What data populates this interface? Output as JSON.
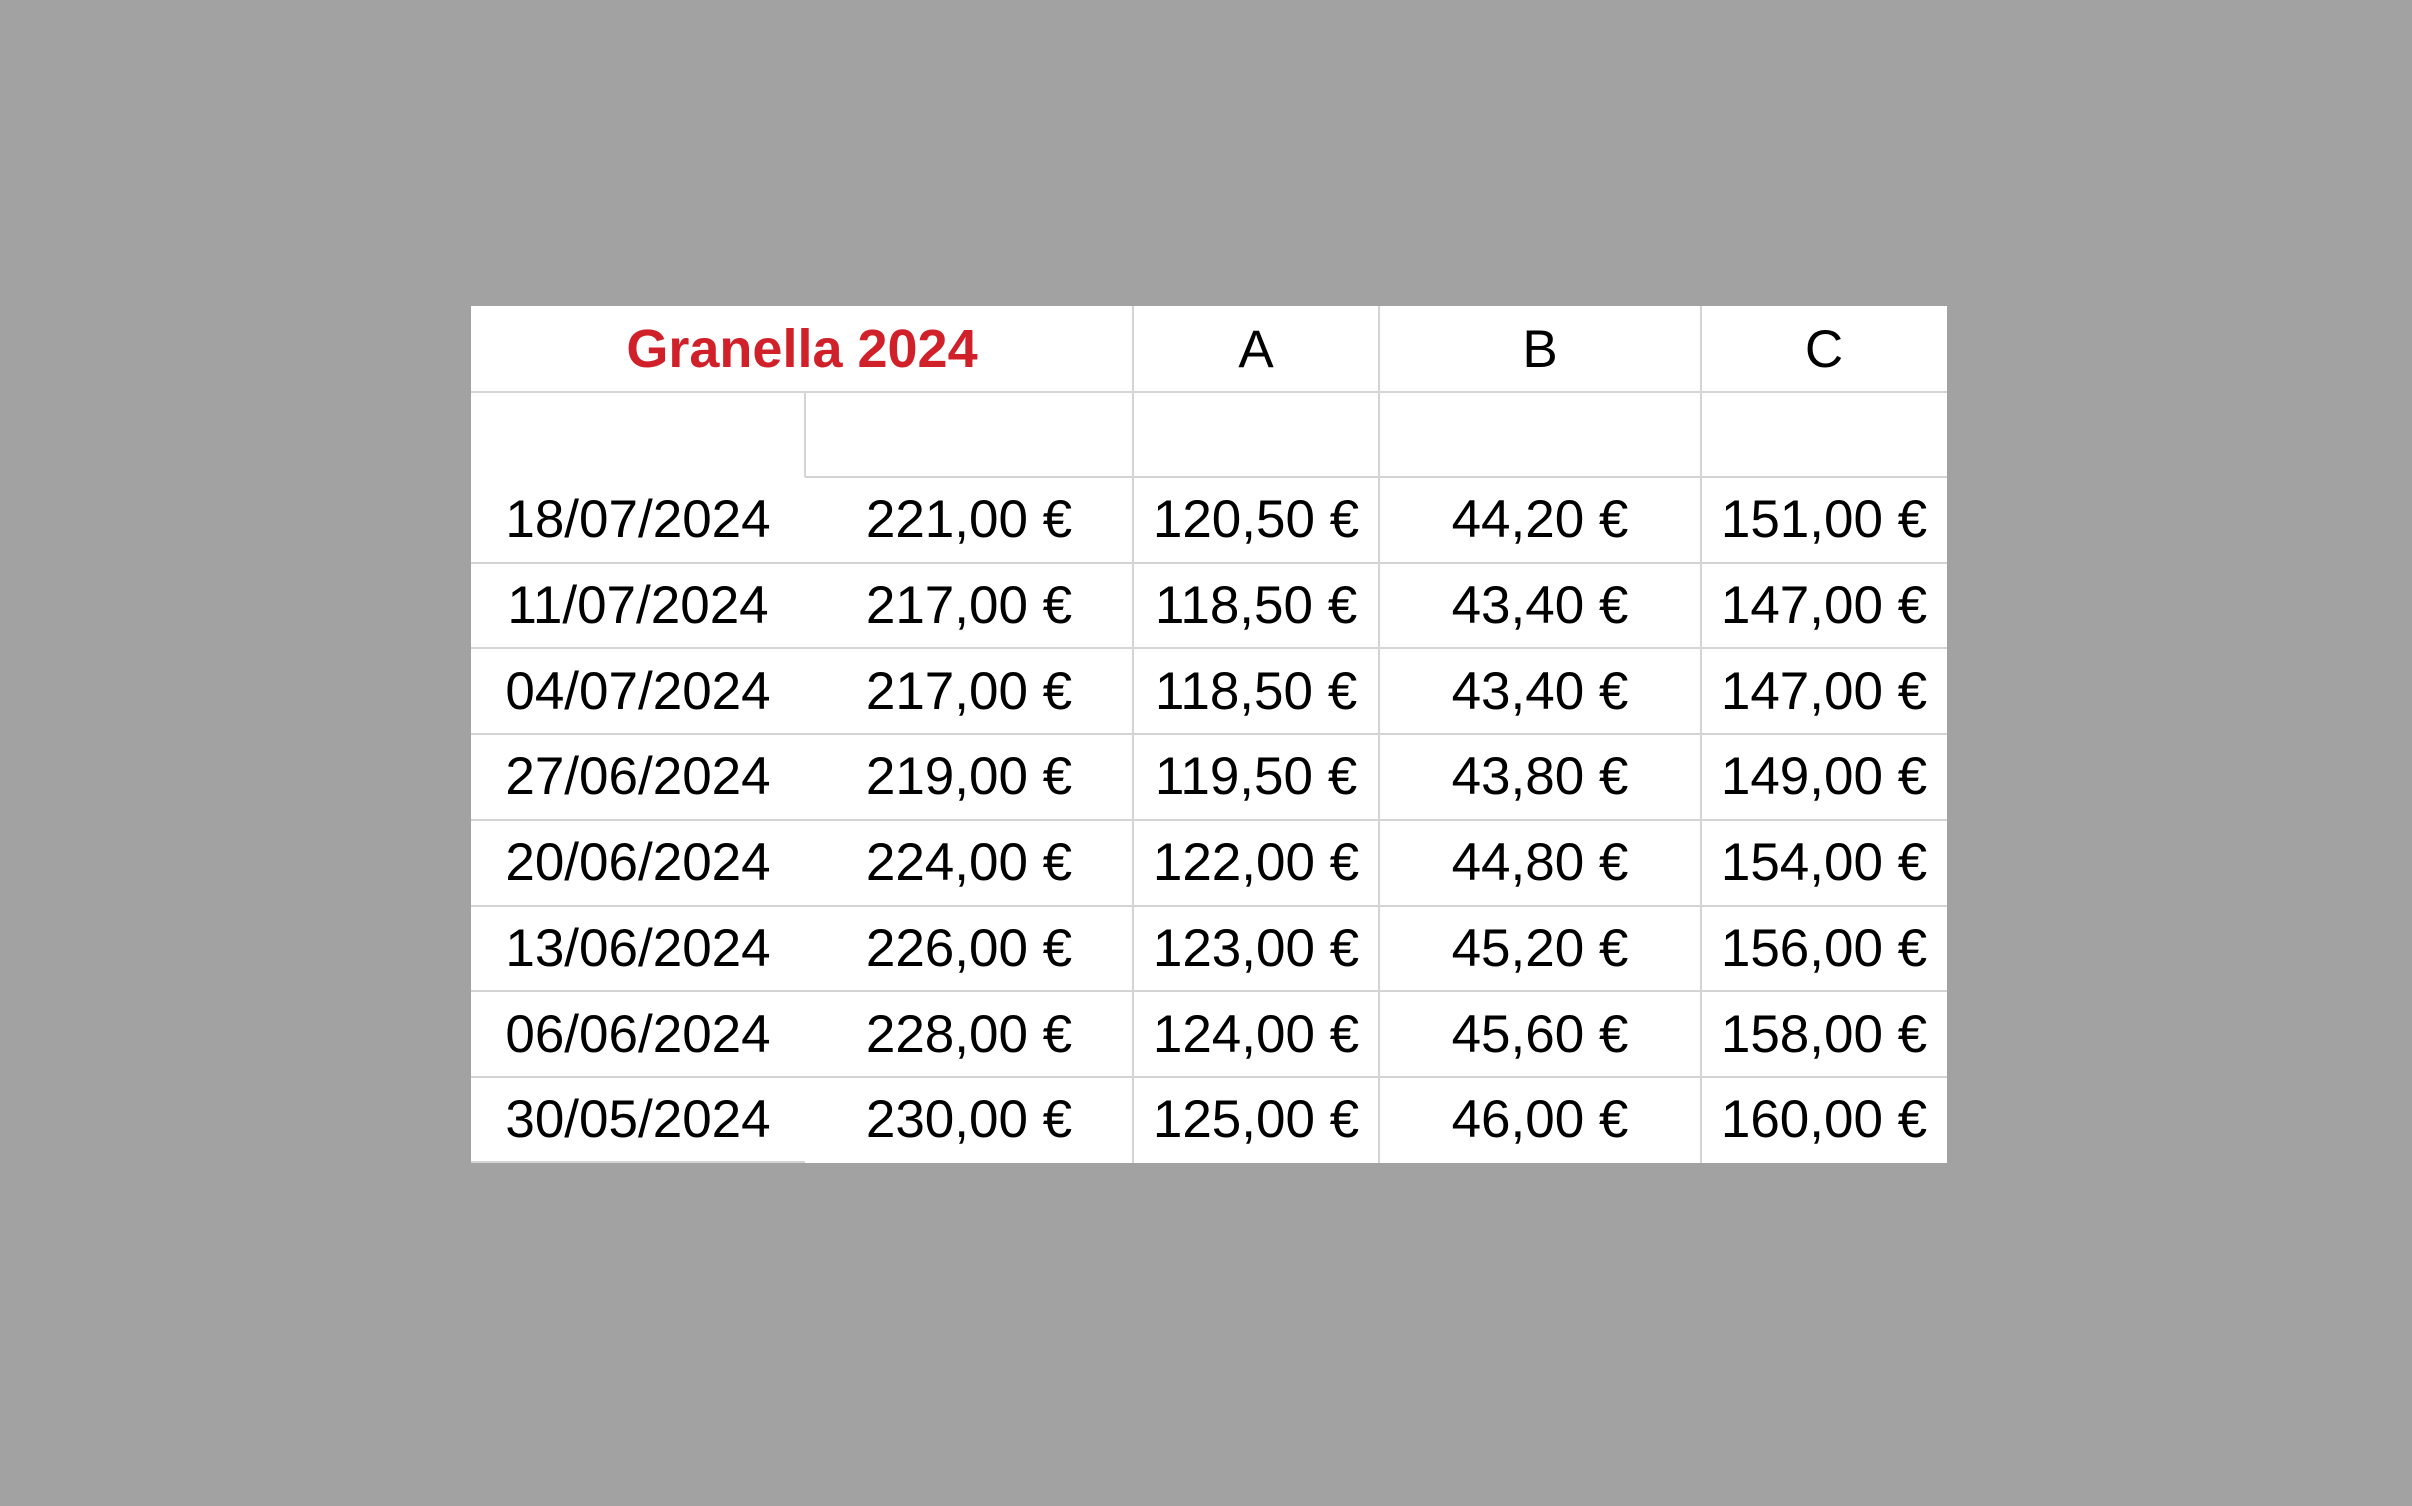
{
  "table": {
    "title": "Granella 2024",
    "headers": [
      "A",
      "B",
      "C"
    ],
    "rows": [
      {
        "date": "18/07/2024",
        "price": "221,00 €",
        "a": "120,50 €",
        "b": "44,20 €",
        "c": "151,00 €"
      },
      {
        "date": "11/07/2024",
        "price": "217,00 €",
        "a": "118,50 €",
        "b": "43,40 €",
        "c": "147,00 €"
      },
      {
        "date": "04/07/2024",
        "price": "217,00 €",
        "a": "118,50 €",
        "b": "43,40 €",
        "c": "147,00 €"
      },
      {
        "date": "27/06/2024",
        "price": "219,00 €",
        "a": "119,50 €",
        "b": "43,80 €",
        "c": "149,00 €"
      },
      {
        "date": "20/06/2024",
        "price": "224,00 €",
        "a": "122,00 €",
        "b": "44,80 €",
        "c": "154,00 €"
      },
      {
        "date": "13/06/2024",
        "price": "226,00 €",
        "a": "123,00 €",
        "b": "45,20 €",
        "c": "156,00 €"
      },
      {
        "date": "06/06/2024",
        "price": "228,00 €",
        "a": "124,00 €",
        "b": "45,60 €",
        "c": "158,00 €"
      },
      {
        "date": "30/05/2024",
        "price": "230,00 €",
        "a": "125,00 €",
        "b": "46,00 €",
        "c": "160,00 €"
      }
    ]
  }
}
